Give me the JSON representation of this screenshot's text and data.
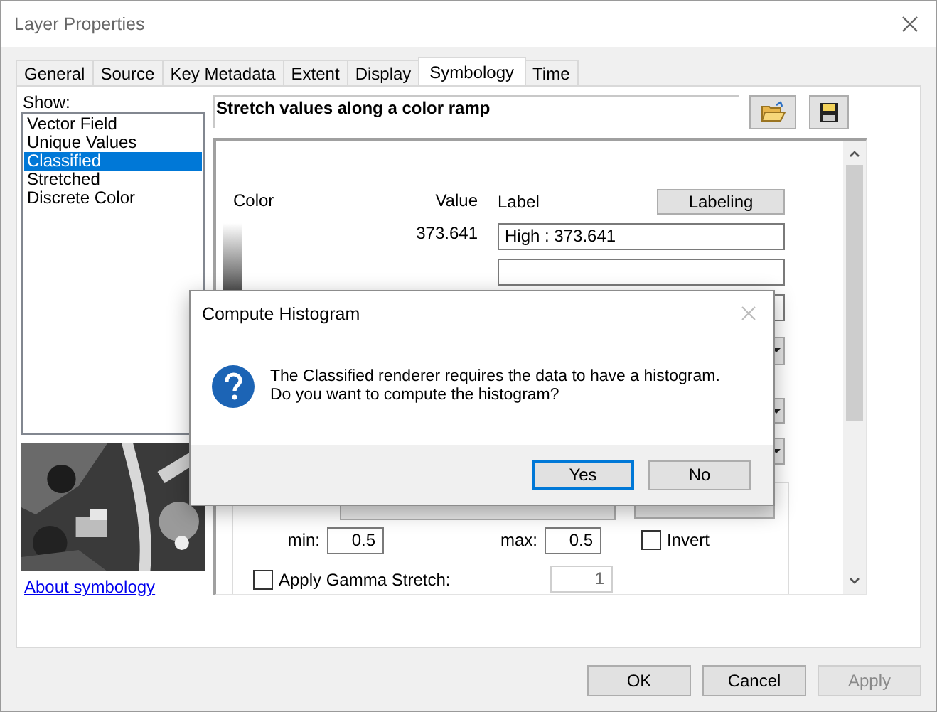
{
  "window": {
    "title": "Layer Properties"
  },
  "tabs": [
    {
      "label": "General",
      "selected": false
    },
    {
      "label": "Source",
      "selected": false
    },
    {
      "label": "Key Metadata",
      "selected": false
    },
    {
      "label": "Extent",
      "selected": false
    },
    {
      "label": "Display",
      "selected": false
    },
    {
      "label": "Symbology",
      "selected": true
    },
    {
      "label": "Time",
      "selected": false
    }
  ],
  "show": {
    "label": "Show:",
    "items": [
      {
        "label": "Vector Field",
        "selected": false
      },
      {
        "label": "Unique Values",
        "selected": false
      },
      {
        "label": "Classified",
        "selected": true
      },
      {
        "label": "Stretched",
        "selected": false
      },
      {
        "label": "Discrete Color",
        "selected": false
      }
    ]
  },
  "about_link": "About symbology",
  "heading": "Stretch values along a color ramp",
  "ramp": {
    "color_header": "Color",
    "value_header": "Value",
    "label_header": "Label",
    "labeling_button": "Labeling",
    "high_value": "373.641",
    "high_label": "High : 373.641"
  },
  "stretch": {
    "min_label": "min:",
    "min": "0.5",
    "max_label": "max:",
    "max": "0.5",
    "invert": {
      "label": "Invert",
      "checked": false
    },
    "gamma": {
      "label": "Apply Gamma Stretch:",
      "checked": false,
      "value": "1",
      "disabled": true
    }
  },
  "buttons": [
    {
      "label": "OK",
      "disabled": false
    },
    {
      "label": "Cancel",
      "disabled": false
    },
    {
      "label": "Apply",
      "disabled": true
    }
  ],
  "dialog": {
    "title": "Compute Histogram",
    "message": [
      "The Classified renderer requires the data to have a histogram.",
      "Do you want to compute the histogram?"
    ],
    "buttons": [
      {
        "label": "Yes",
        "selected": true
      },
      {
        "label": "No",
        "selected": false
      }
    ]
  }
}
